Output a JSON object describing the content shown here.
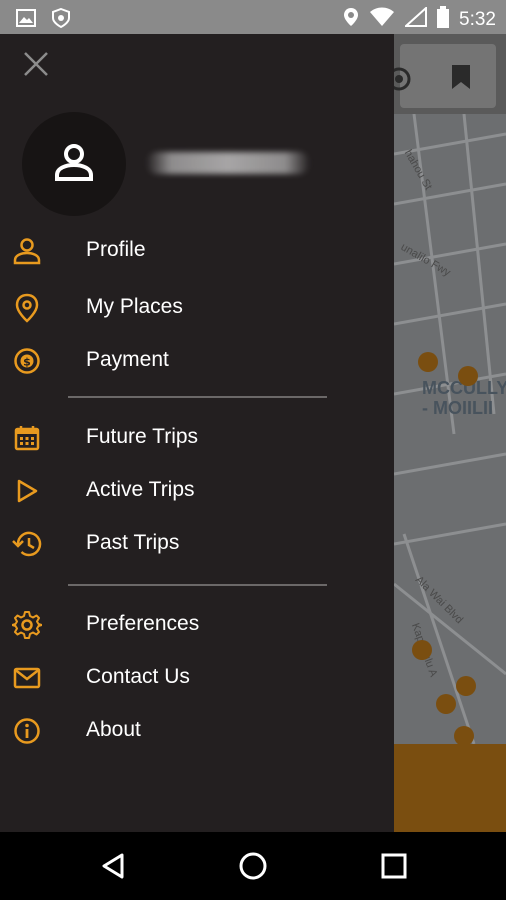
{
  "status_bar": {
    "time": "5:32",
    "icons": [
      "image-icon",
      "shield-icon",
      "location-icon",
      "wifi-icon",
      "signal-icon",
      "battery-icon"
    ]
  },
  "drawer": {
    "user_name": "",
    "groups": [
      [
        {
          "label": "Profile",
          "icon": "person-icon"
        },
        {
          "label": "My Places",
          "icon": "location-pin-icon"
        },
        {
          "label": "Payment",
          "icon": "dollar-coin-icon"
        }
      ],
      [
        {
          "label": "Future Trips",
          "icon": "calendar-icon"
        },
        {
          "label": "Active Trips",
          "icon": "play-icon"
        },
        {
          "label": "Past Trips",
          "icon": "history-icon"
        }
      ],
      [
        {
          "label": "Preferences",
          "icon": "gear-icon"
        },
        {
          "label": "Contact Us",
          "icon": "envelope-icon"
        },
        {
          "label": "About",
          "icon": "info-icon"
        }
      ]
    ]
  },
  "map": {
    "district": "MCCULLY\n- MOIILII",
    "streets": [
      "hahou St",
      "unalilo Fwy",
      "Ala Wai Blvd",
      "Kapahulu A"
    ]
  },
  "colors": {
    "accent": "#e89a1f",
    "drawer_bg": "#231f20",
    "map_bg": "#6c6e70",
    "pin": "#7a4e10"
  },
  "nav_bar": {
    "buttons": [
      "back-icon",
      "home-icon",
      "recents-icon"
    ]
  }
}
